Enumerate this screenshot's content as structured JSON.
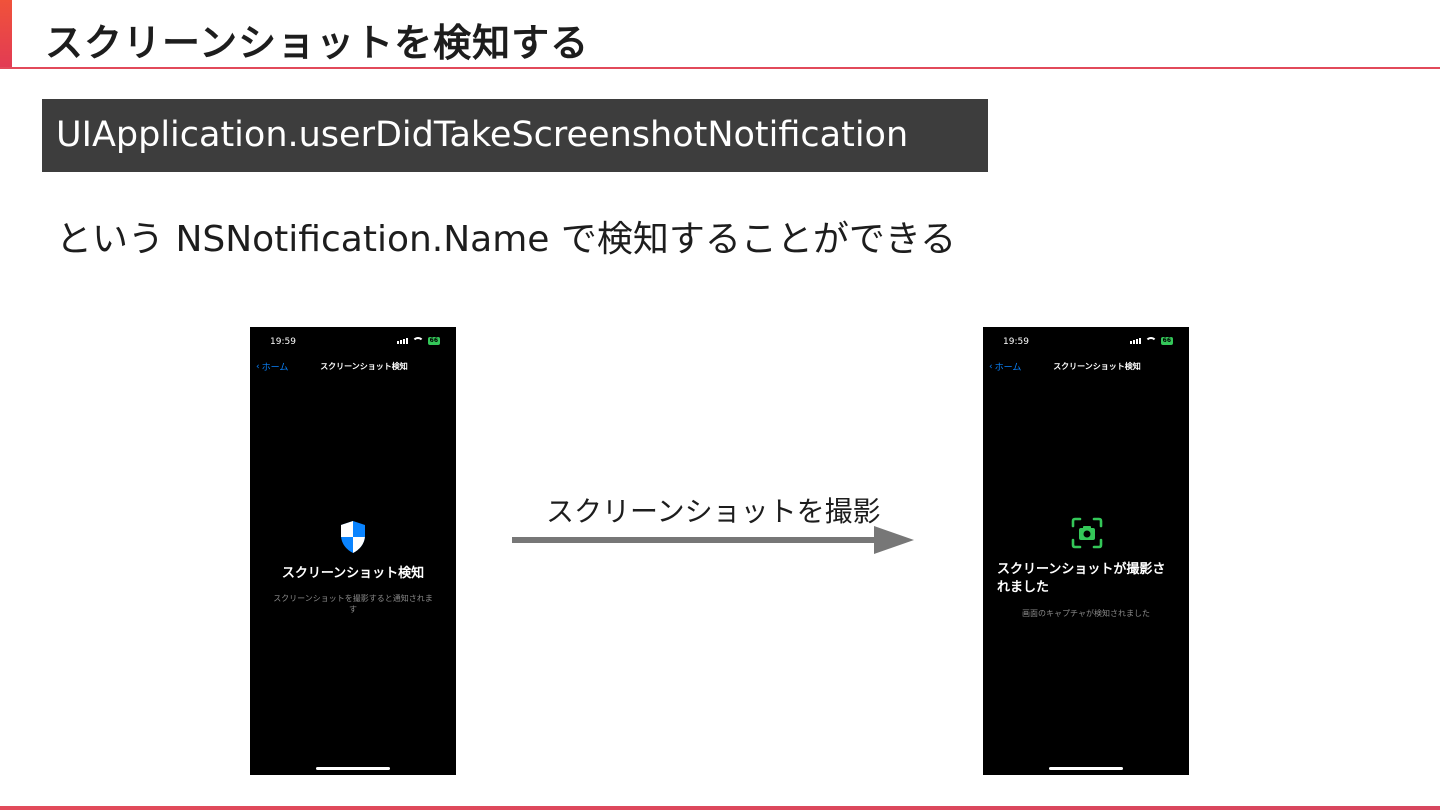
{
  "slide": {
    "title": "スクリーンショットを検知する",
    "api_name": "UIApplication.userDidTakeScreenshotNotification",
    "description": "という NSNotification.Name で検知することができる",
    "arrow_label": "スクリーンショットを撮影"
  },
  "colors": {
    "accent": "#e24a5a",
    "api_box_bg": "#3d3d3d",
    "ios_blue": "#0a84ff",
    "ios_green": "#34c759"
  },
  "phone_before": {
    "time": "19:59",
    "battery": "66",
    "back_label": "ホーム",
    "nav_title": "スクリーンショット検知",
    "icon": "shield-icon",
    "main_title": "スクリーンショット検知",
    "sub_text": "スクリーンショットを撮影すると通知されます"
  },
  "phone_after": {
    "time": "19:59",
    "battery": "66",
    "back_label": "ホーム",
    "nav_title": "スクリーンショット検知",
    "icon": "camera-viewfinder-icon",
    "main_title": "スクリーンショットが撮影されました",
    "sub_text": "画面のキャプチャが検知されました"
  }
}
